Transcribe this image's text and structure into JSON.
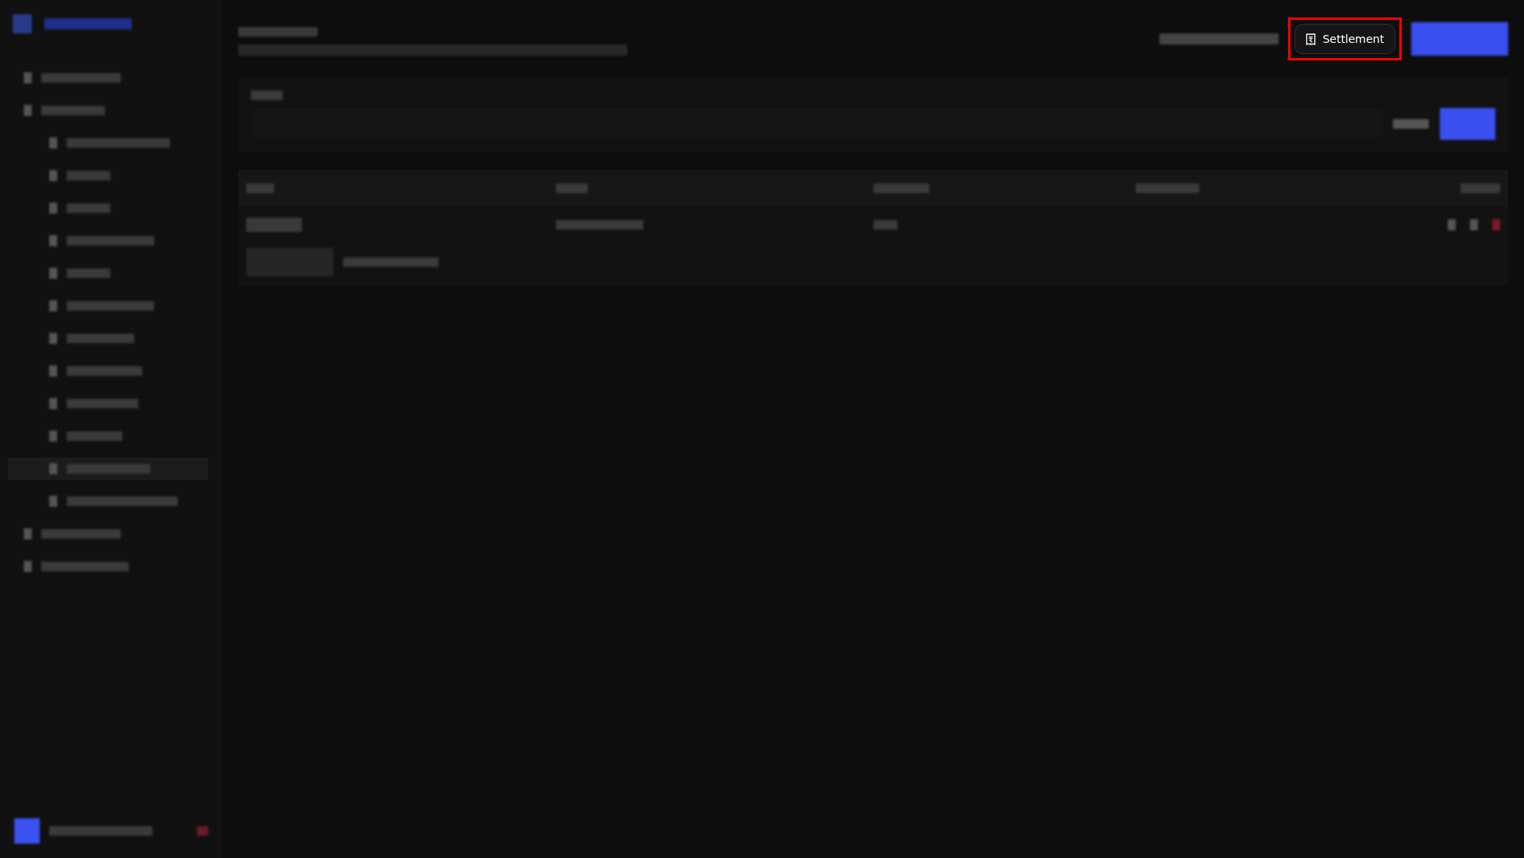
{
  "header": {
    "actions": [
      {
        "label": "Settlement",
        "highlighted": true
      }
    ]
  }
}
